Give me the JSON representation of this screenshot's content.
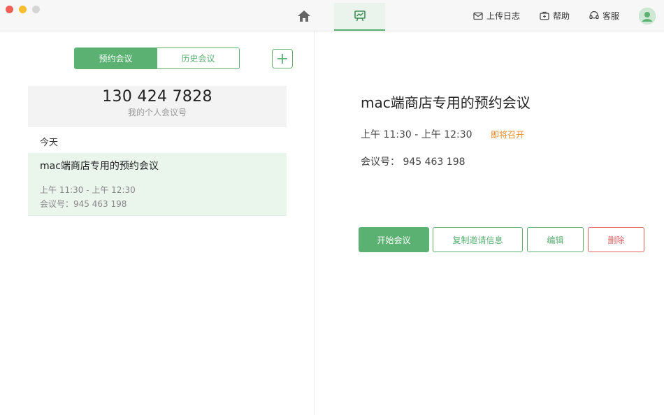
{
  "titlebar": {
    "actions": {
      "upload_log": "上传日志",
      "help": "帮助",
      "service": "客服"
    }
  },
  "tabs": {
    "scheduled": "预约会议",
    "history": "历史会议"
  },
  "personal_meeting": {
    "number": "130 424 7828",
    "label": "我的个人会议号"
  },
  "list": {
    "day_label": "今天",
    "items": [
      {
        "title": "mac端商店专用的预约会议",
        "time": "上午 11:30 - 上午 12:30",
        "meeting_id": "会议号：945 463 198"
      }
    ]
  },
  "detail": {
    "title": "mac端商店专用的预约会议",
    "time": "上午 11:30 - 上午 12:30",
    "status": "即将召开",
    "meeting_id": "会议号：  945 463 198",
    "buttons": {
      "start": "开始会议",
      "copy_invite": "复制邀请信息",
      "edit": "编辑",
      "delete": "删除"
    }
  },
  "colors": {
    "accent": "#5ab172",
    "status_upcoming": "#f08a24",
    "danger": "#e36363"
  }
}
